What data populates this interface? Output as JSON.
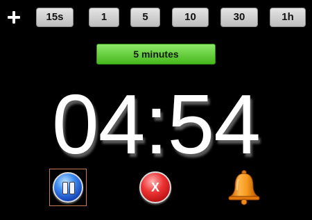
{
  "toolbar": {
    "add_icon": "plus-icon",
    "presets": [
      {
        "label": "15s"
      },
      {
        "label": "1"
      },
      {
        "label": "5"
      },
      {
        "label": "10"
      },
      {
        "label": "30"
      },
      {
        "label": "1h"
      }
    ]
  },
  "selected_duration": "5 minutes",
  "clock": {
    "time": "04:54"
  },
  "controls": {
    "pause_icon": "pause-icon",
    "stop_label": "X",
    "alarm_icon": "bell-icon"
  },
  "colors": {
    "background": "#000000",
    "duration_green": "#46b81c",
    "pause_blue": "#1442b8",
    "stop_red": "#ee3535",
    "bell_orange": "#f08a12"
  }
}
